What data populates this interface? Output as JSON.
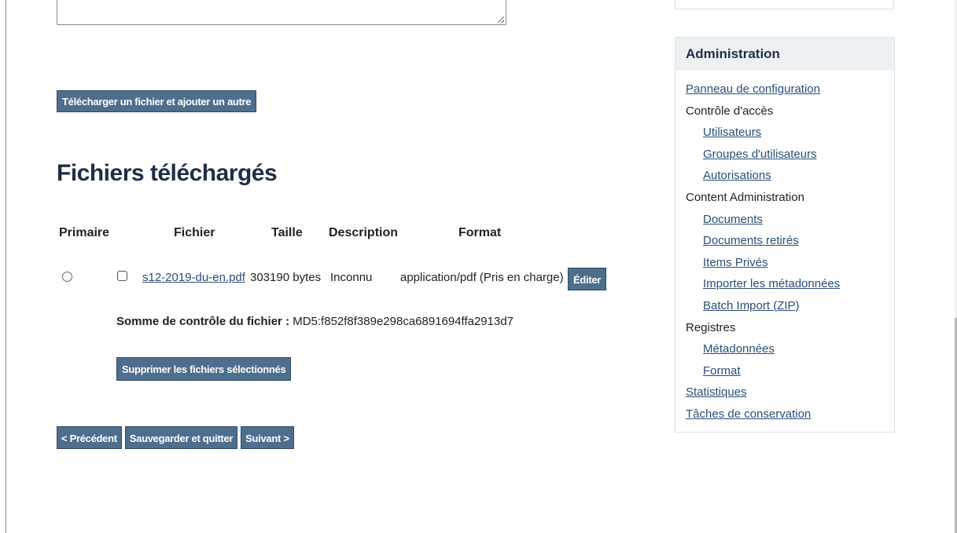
{
  "upload_button": "Télécharger un fichier et ajouter un autre",
  "heading": "Fichiers téléchargés",
  "table": {
    "columns": [
      "Primaire",
      "Fichier",
      "Taille",
      "Description",
      "Format"
    ],
    "row": {
      "file_name": "s12-2019-du-en.pdf",
      "size": "303190 bytes",
      "description": "Inconnu",
      "format": "application/pdf (Pris en charge)",
      "edit_label": "Éditer"
    },
    "checksum_label": "Somme de contrôle du fichier :",
    "checksum_value": "MD5:f852f8f389e298ca6891694ffa2913d7",
    "delete_button": "Supprimer les fichiers sélectionnés"
  },
  "nav": {
    "previous": "< Précédent",
    "save_quit": "Sauvegarder et quitter",
    "next": "Suivant >"
  },
  "sidebar": {
    "title": "Administration",
    "items": [
      {
        "label": "Panneau de configuration",
        "link": true,
        "level": 0
      },
      {
        "label": "Contrôle d'accès",
        "link": false,
        "level": 0
      },
      {
        "label": "Utilisateurs",
        "link": true,
        "level": 1
      },
      {
        "label": "Groupes d'utilisateurs",
        "link": true,
        "level": 1
      },
      {
        "label": "Autorisations",
        "link": true,
        "level": 1
      },
      {
        "label": "Content Administration",
        "link": false,
        "level": 0
      },
      {
        "label": "Documents",
        "link": true,
        "level": 1
      },
      {
        "label": "Documents retirés",
        "link": true,
        "level": 1
      },
      {
        "label": "Items Privés",
        "link": true,
        "level": 1
      },
      {
        "label": "Importer les métadonnées",
        "link": true,
        "level": 1
      },
      {
        "label": "Batch Import (ZIP)",
        "link": true,
        "level": 1
      },
      {
        "label": "Registres",
        "link": false,
        "level": 0
      },
      {
        "label": "Métadonnées",
        "link": true,
        "level": 1
      },
      {
        "label": "Format",
        "link": true,
        "level": 1
      },
      {
        "label": "Statistiques",
        "link": true,
        "level": 0
      },
      {
        "label": "Tâches de conservation",
        "link": true,
        "level": 0
      }
    ]
  },
  "colors": {
    "button_bg": "#4e6e8e",
    "link": "#2a4f78",
    "heading": "#1e2f45",
    "sidebar_header_bg": "#eef1f4"
  }
}
